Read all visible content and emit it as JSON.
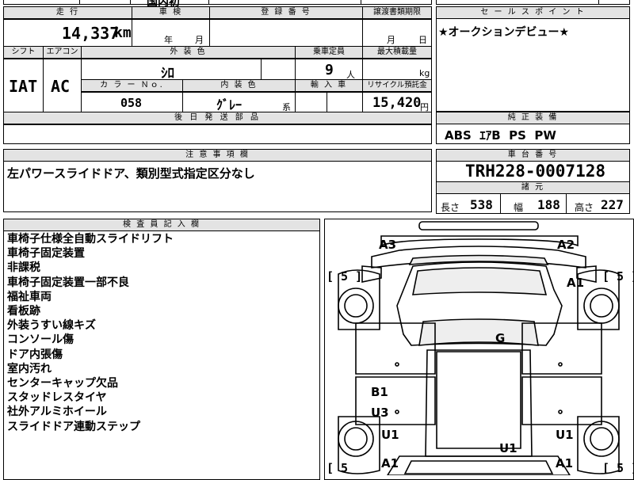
{
  "top_partial": {
    "model_fragment": "国内初"
  },
  "vehicle": {
    "mileage_label": "走 行",
    "mileage_value": "14,337",
    "mileage_unit": "km",
    "shaken_label": "車 検",
    "shaken_year": "年",
    "shaken_month": "月",
    "reg_label": "登 録 番 号",
    "transfer_label": "譲渡書類期限",
    "transfer_month": "月",
    "transfer_day": "日",
    "shift_label": "シフト",
    "shift_value": "IAT",
    "ac_label": "エアコン",
    "ac_value": "AC",
    "color_label": "外 装 色",
    "color_value": "ｼﾛ",
    "capacity_label": "乗車定員",
    "capacity_value": "9",
    "capacity_unit": "人",
    "maxload_label": "最大積載量",
    "maxload_unit": "kg",
    "colorno_label": "カ ラ ー Ｎｏ.",
    "colorno_value": "058",
    "interior_label": "内 装 色",
    "interior_value": "ｸﾞﾚｰ",
    "interior_suffix": "系",
    "import_label": "輸 入 車",
    "recycle_label": "リサイクル預託金",
    "recycle_value": "15,420",
    "recycle_unit": "円",
    "later_label": "後 日 発 送 部 品"
  },
  "sales": {
    "label": "セ ー ル ス ポ イ ン ト",
    "text": "★オークションデビュー★"
  },
  "equipment": {
    "label": "純 正 装 備",
    "text": "ABS  ｴｱB  PS  PW"
  },
  "caution": {
    "label": "注 意 事 項 欄",
    "text": "左パワースライドドア、類別型式指定区分なし"
  },
  "chassis": {
    "label": "車 台 番 号",
    "value": "TRH228-0007128"
  },
  "dims": {
    "label": "諸 元",
    "length_label": "長さ",
    "length_value": "538",
    "width_label": "幅",
    "width_value": "188",
    "height_label": "高さ",
    "height_value": "227"
  },
  "inspector": {
    "label": "検 査 員 記 入 欄",
    "notes": [
      "車椅子仕様全自動スライドリフト",
      "車椅子固定装置",
      "非課税",
      "車椅子固定装置一部不良",
      "福祉車両",
      "看板跡",
      "外装うすい線キズ",
      "コンソール傷",
      "ドア内張傷",
      "室内汚れ",
      "センターキャップ欠品",
      "スタッドレスタイヤ",
      "社外アルミホイール",
      "スライドドア連動ステップ"
    ]
  },
  "diagram": {
    "marks": {
      "a3": "A3",
      "a2": "A2",
      "a1_right_front": "A1",
      "g": "G",
      "b1": "B1",
      "u3": "U3",
      "u1_left": "U1",
      "u1_right": "U1",
      "u1_rear": "U1",
      "a1_left_rear": "A1",
      "a1_right_rear": "A1"
    },
    "tread": {
      "lf": "[ 5 ]",
      "rf": "[ 5 ]",
      "lr": "[ 5",
      "rr": "[ 5 ]"
    }
  }
}
